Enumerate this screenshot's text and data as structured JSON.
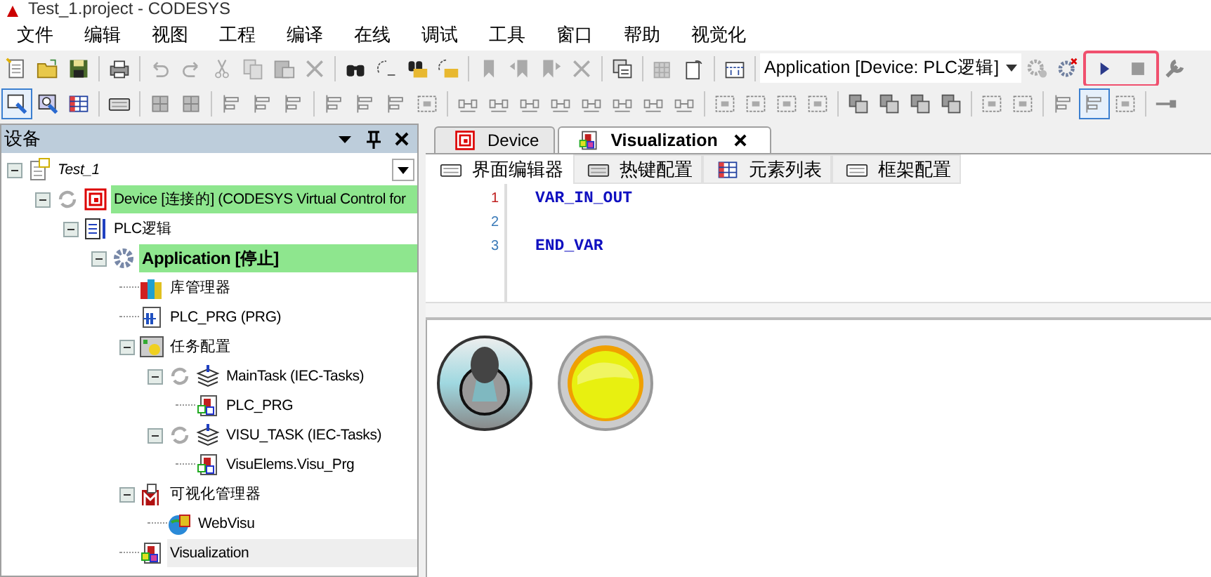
{
  "window": {
    "title": "Test_1.project - CODESYS"
  },
  "menu": [
    "文件",
    "编辑",
    "视图",
    "工程",
    "编译",
    "在线",
    "调试",
    "工具",
    "窗口",
    "帮助",
    "视觉化"
  ],
  "toolbar": {
    "application_selector": "Application [Device: PLC逻辑]"
  },
  "devices_panel": {
    "title": "设备",
    "tree": [
      {
        "label": "Test_1",
        "kind": "project",
        "expanded": true,
        "online": false,
        "selected": false,
        "children": [
          {
            "label": "Device [连接的] (CODESYS Virtual Control for",
            "kind": "device",
            "expanded": true,
            "online": true,
            "selected": false,
            "children": [
              {
                "label": "PLC逻辑",
                "kind": "plc-logic",
                "expanded": true,
                "online": false,
                "selected": false,
                "children": [
                  {
                    "label": "Application [停止]",
                    "kind": "application",
                    "expanded": true,
                    "online": true,
                    "selected": false,
                    "children": [
                      {
                        "label": "库管理器",
                        "kind": "library",
                        "online": false,
                        "selected": false
                      },
                      {
                        "label": "PLC_PRG (PRG)",
                        "kind": "pou",
                        "online": false,
                        "selected": false
                      },
                      {
                        "label": "任务配置",
                        "kind": "task-config",
                        "expanded": true,
                        "online": false,
                        "selected": false,
                        "children": [
                          {
                            "label": "MainTask (IEC-Tasks)",
                            "kind": "task",
                            "expanded": true,
                            "online": false,
                            "selected": false,
                            "children": [
                              {
                                "label": "PLC_PRG",
                                "kind": "program-call",
                                "online": false,
                                "selected": false
                              }
                            ]
                          },
                          {
                            "label": "VISU_TASK (IEC-Tasks)",
                            "kind": "task",
                            "expanded": true,
                            "online": false,
                            "selected": false,
                            "children": [
                              {
                                "label": "VisuElems.Visu_Prg",
                                "kind": "program-call",
                                "online": false,
                                "selected": false
                              }
                            ]
                          }
                        ]
                      },
                      {
                        "label": "可视化管理器",
                        "kind": "visu-manager",
                        "expanded": true,
                        "online": false,
                        "selected": false,
                        "children": [
                          {
                            "label": "WebVisu",
                            "kind": "webvisu",
                            "online": false,
                            "selected": false
                          }
                        ]
                      },
                      {
                        "label": "Visualization",
                        "kind": "visualization",
                        "online": false,
                        "selected": true
                      }
                    ]
                  }
                ]
              }
            ]
          }
        ]
      }
    ]
  },
  "editor": {
    "tabs": [
      {
        "label": "Device",
        "kind": "device",
        "selected": false
      },
      {
        "label": "Visualization",
        "kind": "visualization",
        "selected": true
      }
    ],
    "subtabs": [
      {
        "label": "界面编辑器",
        "kind": "editor",
        "selected": true
      },
      {
        "label": "热键配置",
        "kind": "keyboard",
        "selected": false
      },
      {
        "label": "元素列表",
        "kind": "list",
        "selected": false
      },
      {
        "label": "框架配置",
        "kind": "editor",
        "selected": false
      }
    ],
    "code": [
      {
        "number": "1",
        "text": "VAR_IN_OUT",
        "current": true
      },
      {
        "number": "2",
        "current": false
      },
      {
        "number": "3",
        "text": "END_VAR",
        "current": false
      }
    ]
  },
  "canvas": {
    "elements": [
      {
        "kind": "toggle-switch"
      },
      {
        "kind": "lamp",
        "on": true
      }
    ]
  }
}
